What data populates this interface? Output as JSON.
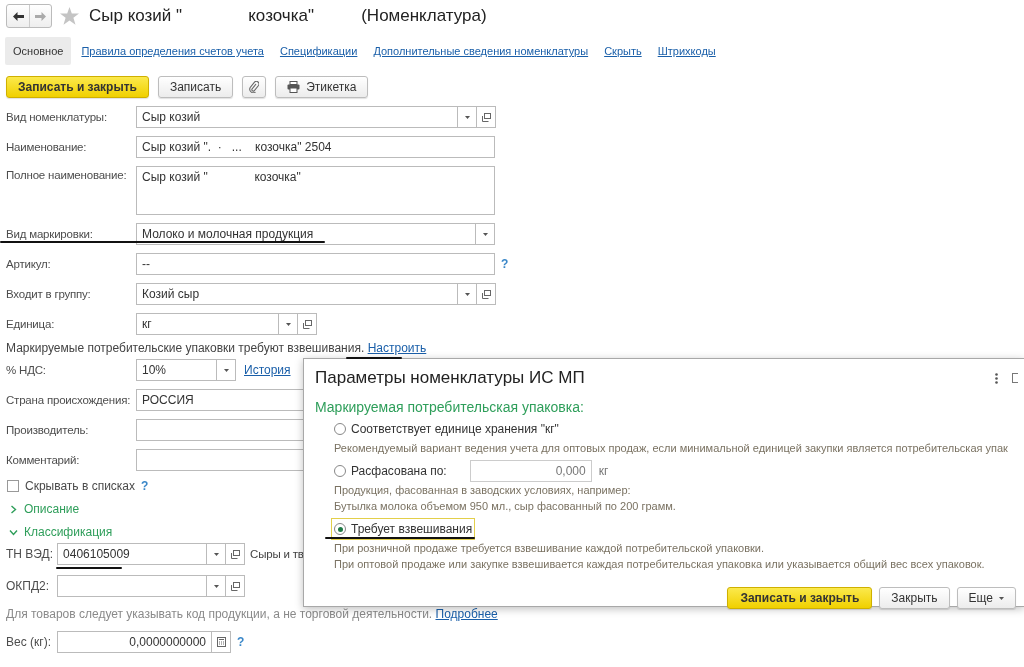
{
  "header": {
    "title": "Сыр козий \"              козочка\"          (Номенклатура)"
  },
  "tabs": [
    {
      "label": "Основное",
      "selected": true
    },
    {
      "label": "Правила определения счетов учета",
      "selected": false
    },
    {
      "label": "Спецификации",
      "selected": false
    },
    {
      "label": "Дополнительные сведения номенклатуры",
      "selected": false
    },
    {
      "label": "Скрыть",
      "selected": false
    },
    {
      "label": "Штрихкоды",
      "selected": false
    }
  ],
  "toolbar": [
    {
      "kind": "primary",
      "label": "Записать и закрыть"
    },
    {
      "kind": "plain",
      "label": "Записать"
    },
    {
      "kind": "attach"
    },
    {
      "kind": "print",
      "label": "Этикетка"
    }
  ],
  "fields": [
    {
      "kind": "combo",
      "label": "Вид номенклатуры:",
      "value": "Сыр козий"
    },
    {
      "kind": "input",
      "label": "Наименование:",
      "value": "Сыр козий \".  ·   ...    козочка\" 2504"
    },
    {
      "kind": "textarea",
      "label": "Полное наименование:",
      "value": "Сыр козий \"              козочка\""
    },
    {
      "kind": "select",
      "label": "Вид маркировки:",
      "value": "Молоко и молочная продукция"
    },
    {
      "kind": "input-help",
      "label": "Артикул:",
      "value": "--",
      "help": "?"
    },
    {
      "kind": "combo",
      "label": "Входит в группу:",
      "value": "Козий сыр"
    },
    {
      "kind": "combo-short",
      "label": "Единица:",
      "value": "кг"
    },
    {
      "kind": "notice",
      "text": "Маркируемые потребительские упаковки требуют взвешивания.",
      "link": "Настроить"
    },
    {
      "kind": "select-link",
      "label": "% НДС:",
      "value": "10%",
      "link": "История"
    },
    {
      "kind": "input",
      "label": "Страна происхождения:",
      "value": "РОССИЯ"
    },
    {
      "kind": "input",
      "label": "Производитель:"
    },
    {
      "kind": "input",
      "label": "Комментарий:"
    }
  ],
  "hide_in_lists": {
    "label": "Скрывать в списках",
    "checked": false,
    "help": "?"
  },
  "groups": [
    {
      "label": "Описание",
      "expanded": false
    },
    {
      "label": "Классификация",
      "expanded": true
    }
  ],
  "classification": [
    {
      "kind": "combo",
      "label": "ТН ВЭД:",
      "value": "0406105009",
      "note": "Сыры и тв"
    },
    {
      "kind": "combo",
      "label": "ОКПД2:"
    },
    {
      "kind": "notice",
      "text": "Для товаров следует указывать код продукции, а не торговой деятельности.",
      "link": "Подробнее"
    },
    {
      "kind": "number",
      "label": "Вес (кг):",
      "value": "0,0000000000",
      "help": "?"
    }
  ],
  "dialog": {
    "title": "Параметры номенклатуры ИС МП",
    "heading": "Маркируемая потребительская упаковка:",
    "options": [
      {
        "label": "Соответствует единице хранения \"кг\"",
        "selected": false,
        "description": [
          "Рекомендуемый вариант ведения учета для оптовых продаж, если минимальной единицей закупки является потребительская упак"
        ]
      },
      {
        "label": "Расфасована по:",
        "selected": false,
        "value": "0,000",
        "unit": "кг",
        "description": [
          "Продукция, фасованная в заводских условиях, например:",
          "Бутылка молока объемом 950 мл., сыр фасованный по 200 грамм."
        ]
      },
      {
        "label": "Требует взвешивания",
        "selected": true,
        "description": [
          "При розничной продаже требуется взвешивание каждой потребительской упаковки.",
          "При оптовой продаже или закупке взвешивается каждая потребительская упаковка или указывается общий вес всех упаковок."
        ]
      }
    ],
    "buttons": [
      {
        "kind": "primary",
        "label": "Записать и закрыть"
      },
      {
        "kind": "plain",
        "label": "Закрыть"
      },
      {
        "kind": "menu",
        "label": "Еще"
      }
    ]
  }
}
